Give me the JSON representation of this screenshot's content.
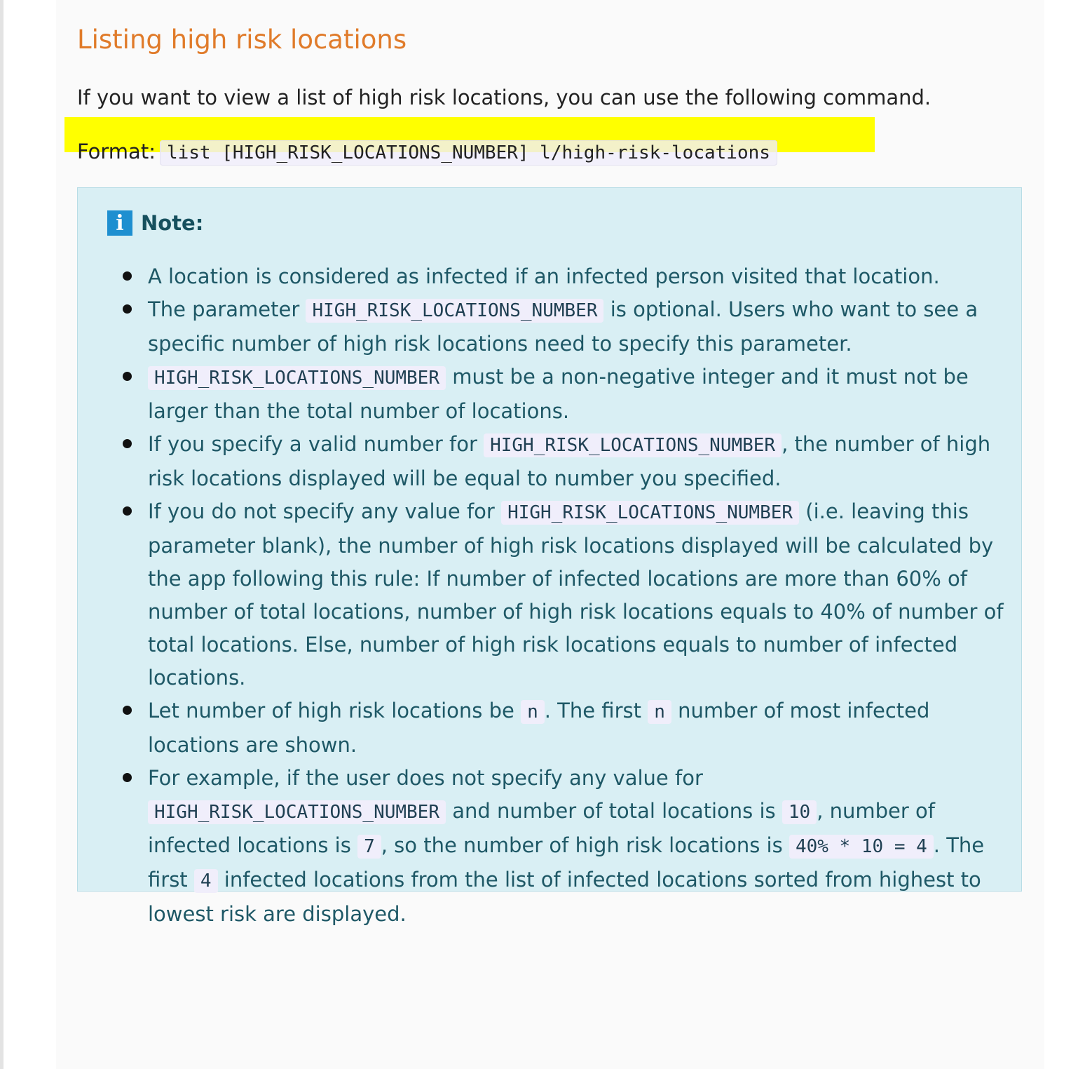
{
  "heading": "Listing high risk locations",
  "intro": "If you want to view a list of high risk locations, you can use the following command.",
  "format": {
    "label": "Format:",
    "command": "list [HIGH_RISK_LOCATIONS_NUMBER] l/high-risk-locations"
  },
  "note": {
    "title": "Note:",
    "icon": "info-icon",
    "items": [
      {
        "text": "A location is considered as infected if an infected person visited that location."
      },
      {
        "pre": "The parameter ",
        "code": "HIGH_RISK_LOCATIONS_NUMBER",
        "post": " is optional. Users who want to see a specific number of high risk locations need to specify this parameter."
      },
      {
        "code": "HIGH_RISK_LOCATIONS_NUMBER",
        "post": " must be a non-negative integer and it must not be larger than the total number of locations."
      },
      {
        "pre": "If you specify a valid number for ",
        "code": "HIGH_RISK_LOCATIONS_NUMBER",
        "post": ", the number of high risk locations displayed will be equal to number you specified."
      },
      {
        "pre": "If you do not specify any value for ",
        "code": "HIGH_RISK_LOCATIONS_NUMBER",
        "post": " (i.e. leaving this parameter blank), the number of high risk locations displayed will be calculated by the app following this rule: If number of infected locations are more than 60% of number of total locations, number of high risk locations equals to 40% of number of total locations. Else, number of high risk locations equals to number of infected locations."
      },
      {
        "pre": "Let number of high risk locations be ",
        "code1": "n",
        "mid": ". The first ",
        "code2": "n",
        "post": " number of most infected locations are shown."
      },
      {
        "pre": "For example, if the user does not specify any value for ",
        "code1": "HIGH_RISK_LOCATIONS_NUMBER",
        "mid1": " and number of total locations is ",
        "code2": "10",
        "mid2": ", number of infected locations is ",
        "code3": "7",
        "mid3": ", so the number of high risk locations is ",
        "code4": "40% * 10 = 4",
        "mid4": ". The first ",
        "code5": "4",
        "post": " infected locations from the list of infected locations sorted from highest to lowest risk are displayed."
      }
    ]
  },
  "colors": {
    "heading": "#e07b2a",
    "highlight": "#ffff00",
    "note_background": "#d9eff4",
    "note_text": "#1e5866",
    "info_icon": "#1e8fd0"
  }
}
